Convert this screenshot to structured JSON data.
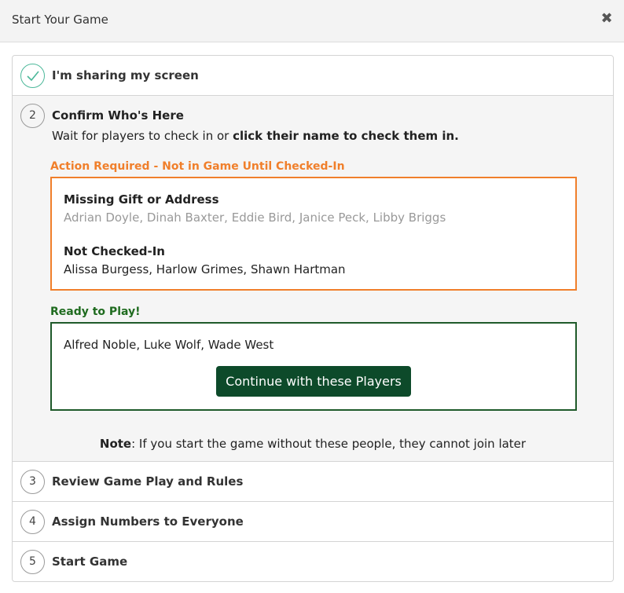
{
  "modal": {
    "title": "Start Your Game",
    "close_icon": "times-icon"
  },
  "steps": [
    {
      "number": "1",
      "status": "done",
      "title": "I'm sharing my screen"
    },
    {
      "number": "2",
      "status": "active",
      "title": "Confirm Who's Here",
      "instructions_prefix": "Wait for players to check in or ",
      "instructions_bold": "click their name to check them in.",
      "action_required_heading": "Action Required - Not in Game Until Checked-In",
      "missing_heading": "Missing Gift or Address",
      "missing_names": "Adrian Doyle, Dinah Baxter, Eddie Bird, Janice Peck, Libby Briggs",
      "not_checked_heading": "Not Checked-In",
      "not_checked_names": "Alissa Burgess, Harlow Grimes, Shawn Hartman",
      "ready_heading": "Ready to Play!",
      "ready_names": "Alfred Noble, Luke Wolf, Wade West",
      "continue_label": "Continue with these Players",
      "note_label": "Note",
      "note_text": ": If you start the game without these people, they cannot join later"
    },
    {
      "number": "3",
      "status": "pending",
      "title": "Review Game Play and Rules"
    },
    {
      "number": "4",
      "status": "pending",
      "title": "Assign Numbers to Everyone"
    },
    {
      "number": "5",
      "status": "pending",
      "title": "Start Game"
    }
  ],
  "colors": {
    "action_orange": "#f07f2b",
    "ready_green": "#1f6b1f",
    "button_green": "#0d4a2a",
    "check_teal": "#4cb89a"
  }
}
